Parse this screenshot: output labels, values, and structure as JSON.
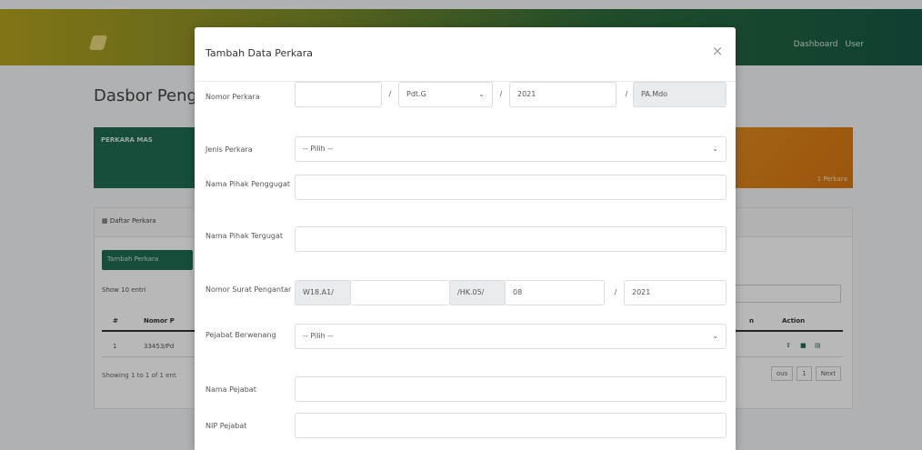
{
  "background": {
    "topnav": {
      "dashboard": "Dashboard",
      "user": "User"
    },
    "dash_title": "Dasbor Peng",
    "card_green_label": "PERKARA MAS",
    "card_orange_value": "1 Perkara",
    "panel_head": "Daftar Perkara",
    "add_button": "Tambah Perkara",
    "show_label": "Show  10  entri",
    "table_headers": [
      "#",
      "Nomor P",
      "n",
      "Action"
    ],
    "table_row": [
      "1",
      "33453/Pd"
    ],
    "footer": "Showing 1 to 1 of 1 ent",
    "pager": [
      "ous",
      "1",
      "Next"
    ]
  },
  "modal": {
    "title": "Tambah Data Perkara",
    "close_icon": "×",
    "fields": {
      "nomor_perkara": {
        "label": "Nomor Perkara",
        "number_value": "",
        "sep1": "/",
        "type_value": "Pdt.G",
        "sep2": "/",
        "year_value": "2021",
        "sep3": "/",
        "court_value": "PA.Mdo"
      },
      "jenis_perkara": {
        "label": "Jenis Perkara",
        "value": "-- Pilih --"
      },
      "nama_penggugat": {
        "label": "Nama Pihak Penggugat",
        "value": ""
      },
      "nama_tergugat": {
        "label": "Nama Pihak Tergugat",
        "value": ""
      },
      "nomor_surat": {
        "label": "Nomor Surat Pengantar",
        "prefix": "W18.A1/",
        "number_value": "",
        "middle": "/HK.05/",
        "month_value": "08",
        "sep": "/",
        "year_value": "2021"
      },
      "pejabat_berwenang": {
        "label": "Pejabat Berwenang",
        "value": "-- Pilih --"
      },
      "nama_pejabat": {
        "label": "Nama Pejabat",
        "value": ""
      },
      "nip_pejabat": {
        "label": "NIP Pejabat",
        "value": ""
      }
    }
  }
}
